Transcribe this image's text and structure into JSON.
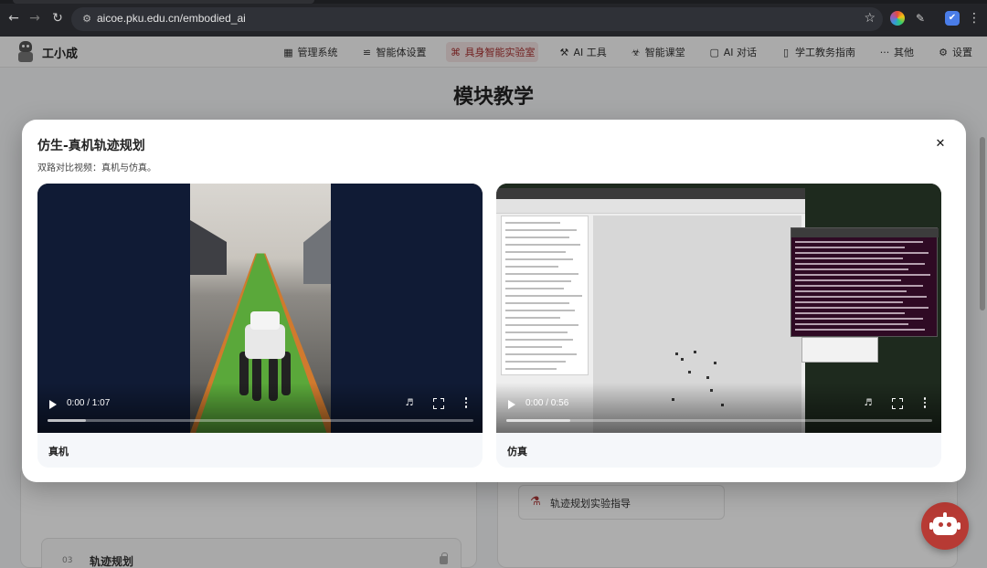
{
  "browser": {
    "url": "aicoe.pku.edu.cn/embodied_ai"
  },
  "app": {
    "name": "工小成"
  },
  "nav": {
    "items": [
      {
        "label": "管理系统",
        "icon": "grid-icon"
      },
      {
        "label": "智能体设置",
        "icon": "sliders-icon"
      },
      {
        "label": "具身智能实验室",
        "icon": "lab-icon",
        "active": true
      },
      {
        "label": "AI 工具",
        "icon": "tool-icon"
      },
      {
        "label": "智能课堂",
        "icon": "classroom-icon"
      },
      {
        "label": "AI 对话",
        "icon": "chat-icon"
      },
      {
        "label": "学工教务指南",
        "icon": "bookmark-icon"
      },
      {
        "label": "其他",
        "icon": "more-icon"
      },
      {
        "label": "设置",
        "icon": "gear-icon"
      }
    ]
  },
  "page": {
    "section_title": "模块教学",
    "module": {
      "number": "03",
      "label": "轨迹规划"
    },
    "guide_label": "轨迹规划实验指导"
  },
  "modal": {
    "title": "仿生-真机轨迹规划",
    "subtitle": "双路对比视频：真机与仿真。",
    "videos": [
      {
        "caption": "真机",
        "time": "0:00 / 1:07",
        "buffered_fraction": 0.09
      },
      {
        "caption": "仿真",
        "time": "0:00 / 0:56",
        "buffered_fraction": 0.15
      }
    ]
  },
  "colors": {
    "accent": "#b73a34",
    "nav_active_bg": "#f3e3e3"
  }
}
